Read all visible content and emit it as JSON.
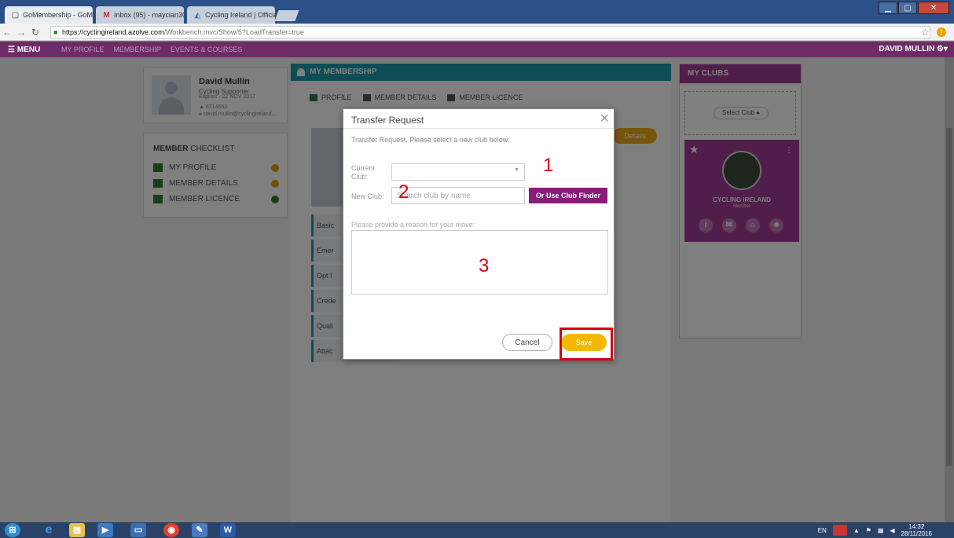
{
  "browser": {
    "tabs": [
      {
        "label": "GoMembership - GoMe",
        "icon": "page-icon"
      },
      {
        "label": "Inbox (95) - maycian30",
        "icon": "gmail-icon"
      },
      {
        "label": "Cycling Ireland | Official",
        "icon": "cycling-icon"
      }
    ],
    "url_host": "https://cyclingireland.azolve.com",
    "url_path": "/Workbench.mvc/Show/5?LoadTransfer=true"
  },
  "appnav": {
    "menu": "MENU",
    "items": [
      "MY PROFILE",
      "MEMBERSHIP",
      "EVENTS & COURSES"
    ],
    "user": "DAVID MULLIN"
  },
  "profile": {
    "name": "David Mullin",
    "role": "Cycling Supporter",
    "expires": "Expires - 22 NOV 2017",
    "id": "8314653",
    "email": "david.mullin@cyclingireland..."
  },
  "checklist": {
    "title_bold": "MEMBER",
    "title_rest": " CHECKLIST",
    "items": [
      "MY PROFILE",
      "MEMBER DETAILS",
      "MEMBER LICENCE"
    ]
  },
  "membership": {
    "title": "MY MEMBERSHIP",
    "tabs": [
      "PROFILE",
      "MEMBER DETAILS",
      "MEMBER LICENCE"
    ],
    "details_btn": "Details",
    "side_items": [
      "Basic",
      "Emer",
      "Opt I",
      "Crede",
      "Quali",
      "Attac"
    ]
  },
  "clubs": {
    "title": "MY CLUBS",
    "select_btn": "Select Club",
    "club_name": "CYCLING IRELAND",
    "club_role": "Member"
  },
  "modal": {
    "title": "Transfer Request",
    "subtitle": "Transfer Request. Please select a new club below:",
    "current_club_label": "Current Club:",
    "new_club_label": "New Club:",
    "new_club_placeholder": "Search club by name",
    "finder_btn": "Or Use Club Finder",
    "reason_label": "Please provide a reason for your move:",
    "cancel": "Cancel",
    "save": "Save",
    "annotations": [
      "1",
      "2",
      "3"
    ]
  },
  "taskbar": {
    "lang": "EN",
    "time": "14:32",
    "date": "28/11/2016"
  },
  "colors": {
    "nav_purple": "#6d2c68",
    "teal": "#1a9aa8",
    "club_purple": "#a23a96",
    "save_yellow": "#f5b800",
    "annotation_red": "#d8000f"
  }
}
